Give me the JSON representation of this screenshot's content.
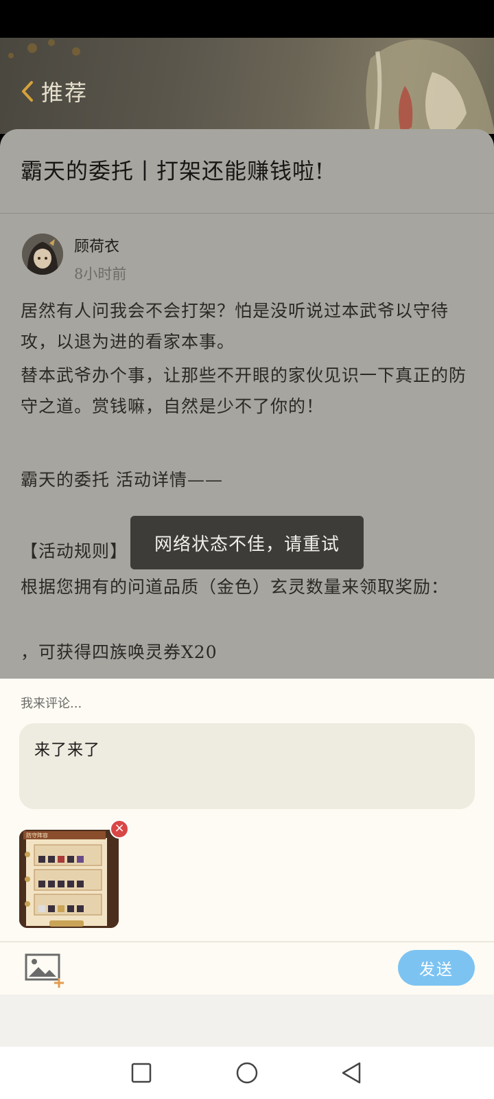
{
  "header": {
    "back_label": "推荐"
  },
  "post": {
    "title": "霸天的委托丨打架还能赚钱啦!",
    "author": {
      "name": "顾荷衣",
      "time": "8小时前"
    },
    "paragraphs": [
      "居然有人问我会不会打架？怕是没听说过本武爷以守待攻，以退为进的看家本事。",
      "替本武爷办个事，让那些不开眼的家伙见识一下真正的防守之道。赏钱嘛，自然是少不了你的！",
      "霸天的委托 活动详情——",
      "【活动规则】",
      "根据您拥有的问道品质（金色）玄灵数量来领取奖励：",
      "，可获得四族唤灵券X20"
    ]
  },
  "toast": {
    "message": "网络状态不佳，请重试"
  },
  "comment": {
    "label": "我来评论...",
    "value": "来了来了",
    "attachment_title": "防守阵容",
    "remove_symbol": "×",
    "send_label": "发送"
  },
  "colors": {
    "send": "#7cc3f2",
    "toast": "#3e3c39",
    "remove": "#d94646"
  }
}
